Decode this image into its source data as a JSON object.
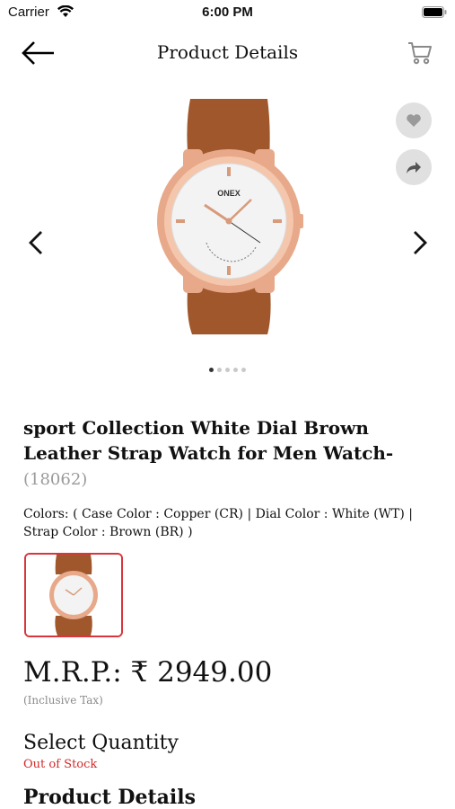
{
  "status": {
    "carrier": "Carrier",
    "time": "6:00 PM"
  },
  "nav": {
    "title": "Product Details"
  },
  "gallery": {
    "image_count": 5,
    "active_index": 0,
    "brand_on_dial": "ONEX"
  },
  "product": {
    "name": "sport Collection White Dial Brown Leather Strap Watch for Men Watch-",
    "code": "(18062)",
    "colors": "Colors:  ( Case Color : Copper (CR) | Dial Color : White (WT) | Strap Color : Brown (BR) )",
    "price": "M.R.P.: ₹ 2949.00",
    "tax_note": "(Inclusive Tax)",
    "quantity_label": "Select Quantity",
    "stock_status": "Out of Stock",
    "details_title": "Product Details"
  },
  "colors_theme": {
    "accent": "#d8363c",
    "stock": "#d12b2b",
    "strap": "#a0572b",
    "case": "#e7a98a"
  }
}
